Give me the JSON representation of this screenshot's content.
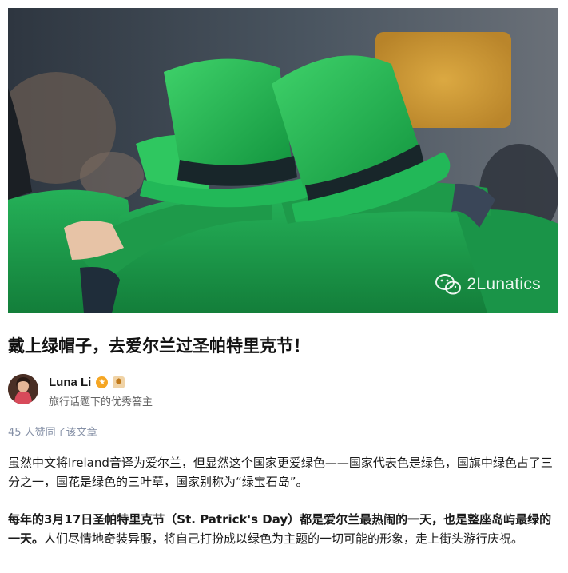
{
  "hero": {
    "watermark": "2Lunatics"
  },
  "article": {
    "title": "戴上绿帽子，去爱尔兰过圣帕特里克节！"
  },
  "author": {
    "name": "Luna Li",
    "description": "旅行话题下的优秀答主"
  },
  "likes": {
    "text": "45 人赞同了该文章"
  },
  "paragraphs": {
    "p1": "虽然中文将Ireland音译为爱尔兰，但显然这个国家更爱绿色——国家代表色是绿色，国旗中绿色占了三分之一，国花是绿色的三叶草，国家别称为“绿宝石岛”。",
    "p2_bold": "每年的3月17日圣帕特里克节（St. Patrick's Day）都是爱尔兰最热闹的一天，也是整座岛屿最绿的一天。",
    "p2_rest": "人们尽情地奇装异服，将自己打扮成以绿色为主题的一切可能的形象，走上街头游行庆祝。"
  },
  "icons": {
    "watermark_icon": "wechat-icon",
    "badge_1": "gold-star-badge-icon",
    "badge_2": "hexagon-badge-icon"
  },
  "colors": {
    "hat_green": "#1fae4a",
    "hat_band": "#1b2a2a",
    "jacket_green": "#1e9a4a",
    "likes_color": "#8590a6"
  }
}
